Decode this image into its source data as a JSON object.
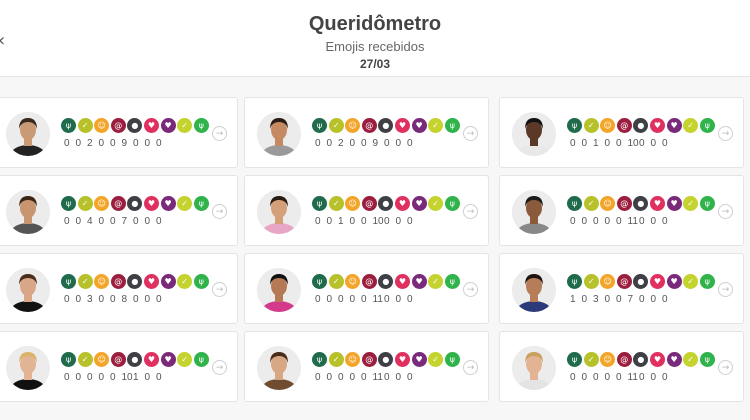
{
  "header": {
    "title": "Queridômetro",
    "subtitle": "Emojis recebidos",
    "date": "27/03",
    "back_icon": "chevron-left-icon"
  },
  "emoji_set": [
    {
      "name": "plant-icon",
      "color": "#1f6b4c",
      "glyph": "ψ"
    },
    {
      "name": "banana-icon",
      "color": "#b7c12a",
      "glyph": "✓"
    },
    {
      "name": "smile-icon",
      "color": "#f3a529",
      "glyph": "☺"
    },
    {
      "name": "snake-icon",
      "color": "#9c1e3e",
      "glyph": "@"
    },
    {
      "name": "bomb-icon",
      "color": "#3f3f46",
      "glyph": "●"
    },
    {
      "name": "broken-heart-icon",
      "color": "#e0305f",
      "glyph": "♥"
    },
    {
      "name": "heart-icon",
      "color": "#7a2a7a",
      "glyph": "♥"
    },
    {
      "name": "lemon-icon",
      "color": "#c5d32f",
      "glyph": "✓"
    },
    {
      "name": "cactus-icon",
      "color": "#2fb34a",
      "glyph": "ψ"
    }
  ],
  "participants": [
    {
      "counts": [
        "0",
        "0",
        "2",
        "0",
        "0",
        "9",
        "0",
        "0",
        "0"
      ],
      "skin": "#c99a73",
      "hair": "#3a2a1e",
      "shirt": "#222222"
    },
    {
      "counts": [
        "0",
        "0",
        "2",
        "0",
        "0",
        "9",
        "0",
        "0",
        "0"
      ],
      "skin": "#c68a62",
      "hair": "#2b1d14",
      "shirt": "#9a9a9a"
    },
    {
      "counts": [
        "0",
        "0",
        "1",
        "0",
        "0",
        "10",
        "0",
        "0",
        "0"
      ],
      "skin": "#5a3a26",
      "hair": "#111111",
      "shirt": "#e8e8e8"
    },
    {
      "counts": [
        "0",
        "0",
        "4",
        "0",
        "0",
        "7",
        "0",
        "0",
        "0"
      ],
      "skin": "#c99470",
      "hair": "#3b2616",
      "shirt": "#555555"
    },
    {
      "counts": [
        "0",
        "0",
        "1",
        "0",
        "0",
        "10",
        "0",
        "0",
        "0"
      ],
      "skin": "#d4a07a",
      "hair": "#2a1c12",
      "shirt": "#e9a6c4"
    },
    {
      "counts": [
        "0",
        "0",
        "0",
        "0",
        "0",
        "11",
        "0",
        "0",
        "0"
      ],
      "skin": "#8a5a3a",
      "hair": "#1a1a1a",
      "shirt": "#888888"
    },
    {
      "counts": [
        "0",
        "0",
        "3",
        "0",
        "0",
        "8",
        "0",
        "0",
        "0"
      ],
      "skin": "#d9a687",
      "hair": "#4a2e1c",
      "shirt": "#111111"
    },
    {
      "counts": [
        "0",
        "0",
        "0",
        "0",
        "0",
        "11",
        "0",
        "0",
        "0"
      ],
      "skin": "#b57a55",
      "hair": "#111111",
      "shirt": "#d33a8c"
    },
    {
      "counts": [
        "1",
        "0",
        "3",
        "0",
        "0",
        "7",
        "0",
        "0",
        "0"
      ],
      "skin": "#b67d58",
      "hair": "#1f1510",
      "shirt": "#2c3a7a"
    },
    {
      "counts": [
        "0",
        "0",
        "0",
        "0",
        "0",
        "10",
        "1",
        "0",
        "0"
      ],
      "skin": "#e1b494",
      "hair": "#d8b56a",
      "shirt": "#111111"
    },
    {
      "counts": [
        "0",
        "0",
        "0",
        "0",
        "0",
        "11",
        "0",
        "0",
        "0"
      ],
      "skin": "#d7a784",
      "hair": "#4a2c1a",
      "shirt": "#6f4c2f"
    },
    {
      "counts": [
        "0",
        "0",
        "0",
        "0",
        "0",
        "11",
        "0",
        "0",
        "0"
      ],
      "skin": "#e3b493",
      "hair": "#c9a060",
      "shirt": "#e4e4e4"
    }
  ]
}
